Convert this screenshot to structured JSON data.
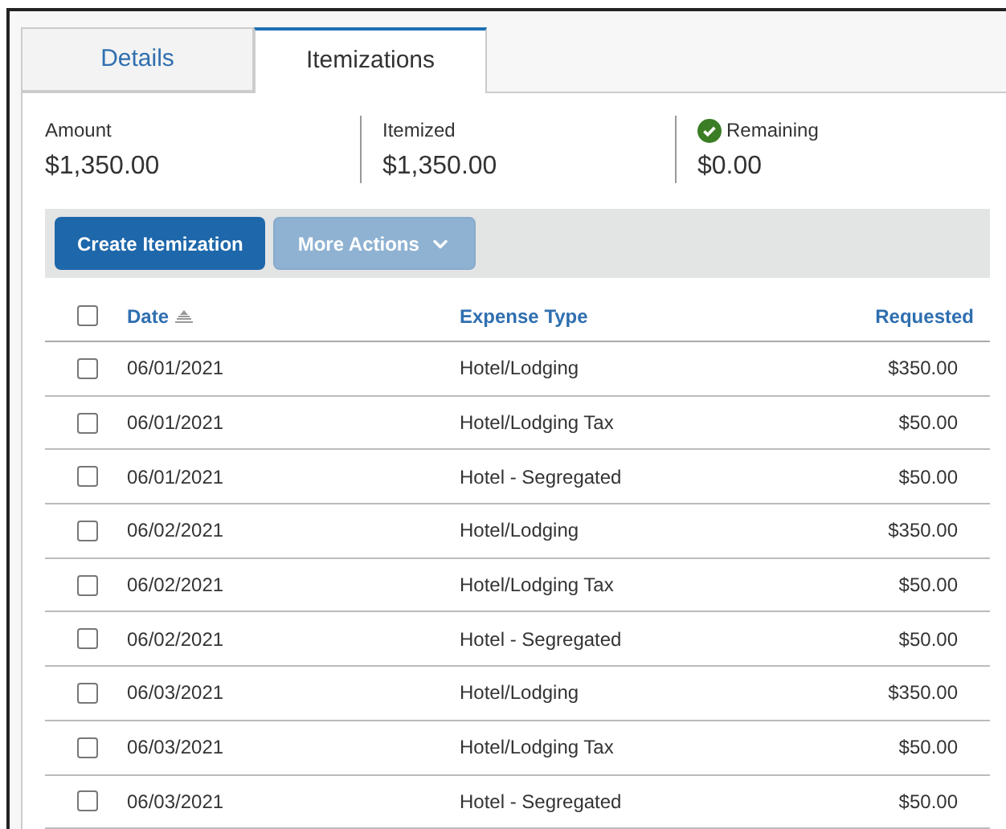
{
  "tabs": [
    {
      "label": "Details",
      "selected": false
    },
    {
      "label": "Itemizations",
      "selected": true
    }
  ],
  "summary": [
    {
      "label": "Amount",
      "value": "$1,350.00",
      "ok": false
    },
    {
      "label": "Itemized",
      "value": "$1,350.00",
      "ok": false
    },
    {
      "label": "Remaining",
      "value": "$0.00",
      "ok": true
    }
  ],
  "toolbar": {
    "buttons": [
      {
        "label": "Create Itemization",
        "disabled": false,
        "dropdown": false
      },
      {
        "label": "More Actions",
        "disabled": true,
        "dropdown": true
      }
    ]
  },
  "table": {
    "select_all": {
      "checked": false
    },
    "columns": [
      {
        "label": "Date",
        "sorted": true
      },
      {
        "label": "Expense Type",
        "sorted": false
      },
      {
        "label": "Requested",
        "sorted": false
      }
    ],
    "rows": [
      {
        "checked": false,
        "date": "06/01/2021",
        "type": "Hotel/Lodging",
        "requested": "$350.00"
      },
      {
        "checked": false,
        "date": "06/01/2021",
        "type": "Hotel/Lodging Tax",
        "requested": "$50.00"
      },
      {
        "checked": false,
        "date": "06/01/2021",
        "type": "Hotel - Segregated",
        "requested": "$50.00"
      },
      {
        "checked": false,
        "date": "06/02/2021",
        "type": "Hotel/Lodging",
        "requested": "$350.00"
      },
      {
        "checked": false,
        "date": "06/02/2021",
        "type": "Hotel/Lodging Tax",
        "requested": "$50.00"
      },
      {
        "checked": false,
        "date": "06/02/2021",
        "type": "Hotel - Segregated",
        "requested": "$50.00"
      },
      {
        "checked": false,
        "date": "06/03/2021",
        "type": "Hotel/Lodging",
        "requested": "$350.00"
      },
      {
        "checked": false,
        "date": "06/03/2021",
        "type": "Hotel/Lodging Tax",
        "requested": "$50.00"
      },
      {
        "checked": false,
        "date": "06/03/2021",
        "type": "Hotel - Segregated",
        "requested": "$50.00"
      }
    ]
  }
}
